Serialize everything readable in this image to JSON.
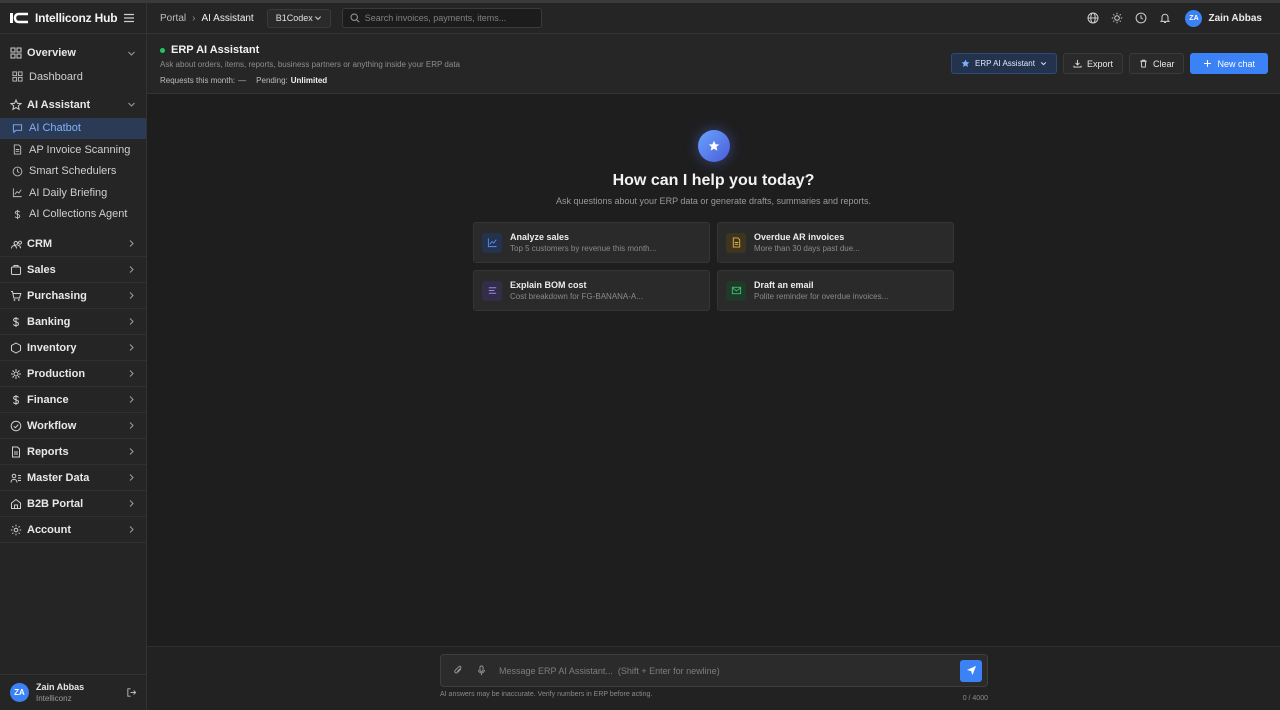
{
  "app": {
    "brand": "Intelliconz Hub"
  },
  "sidebar": {
    "overview": {
      "label": "Overview",
      "items": [
        {
          "label": "Dashboard"
        }
      ]
    },
    "ai_assistant": {
      "label": "AI Assistant",
      "items": [
        {
          "label": "AI Chatbot"
        },
        {
          "label": "AP Invoice Scanning"
        },
        {
          "label": "Smart Schedulers"
        },
        {
          "label": "AI Daily Briefing"
        },
        {
          "label": "AI Collections Agent"
        }
      ]
    },
    "sections": [
      {
        "label": "CRM"
      },
      {
        "label": "Sales"
      },
      {
        "label": "Purchasing"
      },
      {
        "label": "Banking"
      },
      {
        "label": "Inventory"
      },
      {
        "label": "Production"
      },
      {
        "label": "Finance"
      },
      {
        "label": "Workflow"
      },
      {
        "label": "Reports"
      },
      {
        "label": "Master Data"
      },
      {
        "label": "B2B Portal"
      },
      {
        "label": "Account"
      }
    ],
    "footer": {
      "initials": "ZA",
      "name": "Zain Abbas",
      "org": "Intelliconz"
    }
  },
  "topbar": {
    "breadcrumb": [
      "Portal",
      "AI Assistant"
    ],
    "company": "B1Codex",
    "search_placeholder": "Search invoices, payments, items...",
    "user": {
      "initials": "ZA",
      "name": "Zain Abbas"
    }
  },
  "header": {
    "title": "ERP AI Assistant",
    "subtitle": "Ask about orders, items, reports, business partners or anything inside your ERP data",
    "requests_label": "Requests this month:",
    "requests_value": "—",
    "pending_label": "Pending:",
    "pending_value": "Unlimited",
    "model_label": "ERP AI Assistant",
    "export_label": "Export",
    "clear_label": "Clear",
    "new_chat_label": "New chat"
  },
  "hero": {
    "title": "How can I help you today?",
    "subtitle": "Ask questions about your ERP data or generate drafts, summaries and reports."
  },
  "suggestions": [
    {
      "title": "Analyze sales",
      "subtitle": "Top 5 customers by revenue this month...",
      "icon": "chart-line-icon",
      "color": "#5b8def"
    },
    {
      "title": "Overdue AR invoices",
      "subtitle": "More than 30 days past due...",
      "icon": "document-icon",
      "color": "#e0b43a"
    },
    {
      "title": "Explain BOM cost",
      "subtitle": "Cost breakdown for FG-BANANA-A...",
      "icon": "list-icon",
      "color": "#9b87e8"
    },
    {
      "title": "Draft an email",
      "subtitle": "Polite reminder for overdue invoices...",
      "icon": "mail-icon",
      "color": "#3fbf6a"
    }
  ],
  "composer": {
    "placeholder": "Message ERP AI Assistant...  (Shift + Enter for newline)",
    "disclaimer": "AI answers may be inaccurate. Verify numbers in ERP before acting.",
    "counter": "0 / 4000"
  },
  "colors": {
    "accent": "#3b82f6",
    "status": "#22c55e",
    "active_nav_bg": "#2b3a55",
    "active_nav_text": "#7fb1ff"
  }
}
